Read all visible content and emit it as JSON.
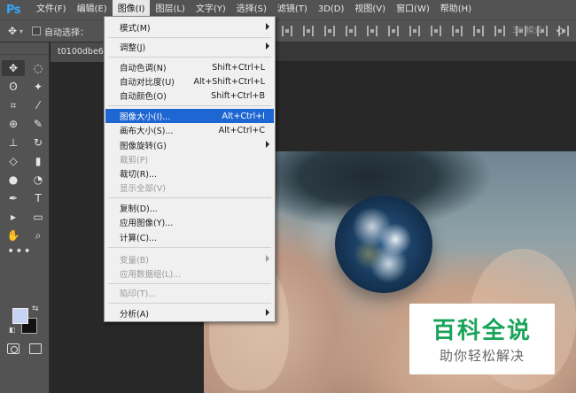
{
  "app": {
    "logo": "Ps"
  },
  "menubar": {
    "items": [
      {
        "label": "文件(F)"
      },
      {
        "label": "编辑(E)"
      },
      {
        "label": "图像(I)",
        "active": true
      },
      {
        "label": "图层(L)"
      },
      {
        "label": "文字(Y)"
      },
      {
        "label": "选择(S)"
      },
      {
        "label": "滤镜(T)"
      },
      {
        "label": "3D(D)"
      },
      {
        "label": "视图(V)"
      },
      {
        "label": "窗口(W)"
      },
      {
        "label": "帮助(H)"
      }
    ]
  },
  "options_bar": {
    "auto_select_label": "自动选择：",
    "mode_3d_label": "3D 模式："
  },
  "document": {
    "tab_title": "t0100dbe62"
  },
  "image_menu": {
    "items": [
      {
        "label": "模式(M)",
        "shortcut": "",
        "submenu": true,
        "disabled": false
      },
      {
        "label": "调整(J)",
        "shortcut": "",
        "submenu": true,
        "disabled": false
      },
      {
        "label": "自动色调(N)",
        "shortcut": "Shift+Ctrl+L",
        "submenu": false,
        "disabled": false
      },
      {
        "label": "自动对比度(U)",
        "shortcut": "Alt+Shift+Ctrl+L",
        "submenu": false,
        "disabled": false
      },
      {
        "label": "自动颜色(O)",
        "shortcut": "Shift+Ctrl+B",
        "submenu": false,
        "disabled": false
      },
      {
        "label": "图像大小(I)...",
        "shortcut": "Alt+Ctrl+I",
        "submenu": false,
        "disabled": false,
        "highlighted": true
      },
      {
        "label": "画布大小(S)...",
        "shortcut": "Alt+Ctrl+C",
        "submenu": false,
        "disabled": false
      },
      {
        "label": "图像旋转(G)",
        "shortcut": "",
        "submenu": true,
        "disabled": false
      },
      {
        "label": "裁剪(P)",
        "shortcut": "",
        "submenu": false,
        "disabled": true
      },
      {
        "label": "裁切(R)...",
        "shortcut": "",
        "submenu": false,
        "disabled": false
      },
      {
        "label": "显示全部(V)",
        "shortcut": "",
        "submenu": false,
        "disabled": true
      },
      {
        "label": "复制(D)...",
        "shortcut": "",
        "submenu": false,
        "disabled": false
      },
      {
        "label": "应用图像(Y)...",
        "shortcut": "",
        "submenu": false,
        "disabled": false
      },
      {
        "label": "计算(C)...",
        "shortcut": "",
        "submenu": false,
        "disabled": false
      },
      {
        "label": "变量(B)",
        "shortcut": "",
        "submenu": true,
        "disabled": true
      },
      {
        "label": "应用数据组(L)...",
        "shortcut": "",
        "submenu": false,
        "disabled": true
      },
      {
        "label": "陷印(T)...",
        "shortcut": "",
        "submenu": false,
        "disabled": true
      },
      {
        "label": "分析(A)",
        "shortcut": "",
        "submenu": true,
        "disabled": false
      }
    ]
  },
  "watermark": {
    "title": "百科全说",
    "subtitle": "助你轻松解决"
  },
  "colors": {
    "foreground": "#c7d3f2",
    "background": "#111111",
    "highlight": "#1e66d2",
    "watermark_green": "#1aa45a"
  }
}
